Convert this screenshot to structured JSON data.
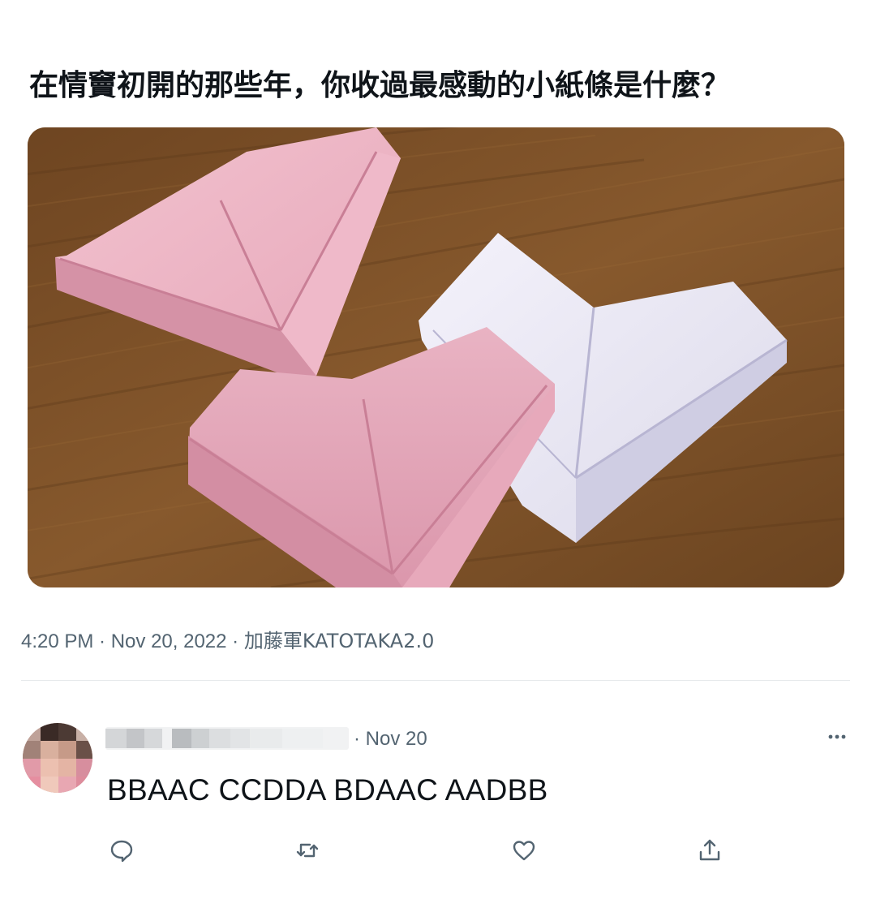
{
  "tweet": {
    "text": "在情竇初開的那些年，你收過最感動的小紙條是什麼？",
    "time": "4:20 PM",
    "separator": " · ",
    "date": "Nov 20, 2022",
    "author": "加藤軍KATOTAKA2.0"
  },
  "reply": {
    "date": "· Nov 20",
    "text": "BBAAC CCDDA BDAAC AADBB"
  },
  "icons": {
    "more": "more-horizontal-icon",
    "reply": "speech-bubble-icon",
    "retweet": "retweet-arrows-icon",
    "like": "heart-icon",
    "share": "share-upload-icon"
  },
  "colors": {
    "text": "#0f1419",
    "secondary": "#536471",
    "divider": "#e6e9eb",
    "accent_blue": "#1d9bf0"
  }
}
